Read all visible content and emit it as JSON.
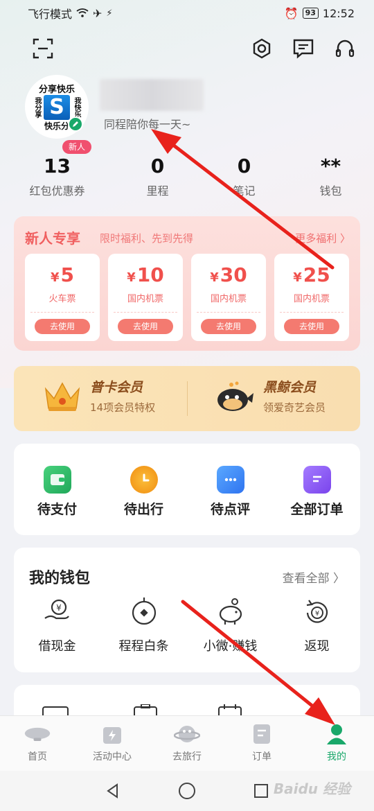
{
  "status_bar": {
    "left_text": "飞行模式",
    "battery": "93",
    "time": "12:52"
  },
  "profile": {
    "avatar": {
      "top": "分享快乐",
      "left": "我分享",
      "right": "我快乐",
      "bottom": "快乐分",
      "logo": "S"
    },
    "new_tag": "新人",
    "slogan": "同程陪你每一天~"
  },
  "stats": [
    {
      "value": "13",
      "label": "红包优惠券"
    },
    {
      "value": "0",
      "label": "里程"
    },
    {
      "value": "0",
      "label": "笔记"
    },
    {
      "value": "**",
      "label": "钱包"
    }
  ],
  "newbie": {
    "title": "新人专享",
    "subtitle": "限时福利、先到先得",
    "more": "更多福利 〉",
    "coupons": [
      {
        "currency": "¥",
        "amount": "5",
        "type": "火车票",
        "action": "去使用"
      },
      {
        "currency": "¥",
        "amount": "10",
        "type": "国内机票",
        "action": "去使用"
      },
      {
        "currency": "¥",
        "amount": "30",
        "type": "国内机票",
        "action": "去使用"
      },
      {
        "currency": "¥",
        "amount": "25",
        "type": "国内机票",
        "action": "去使用"
      }
    ]
  },
  "membership": [
    {
      "title": "普卡会员",
      "subtitle": "14项会员特权"
    },
    {
      "title": "黑鲸会员",
      "subtitle": "领爱奇艺会员"
    }
  ],
  "orders": [
    {
      "label": "待支付",
      "icon": "wallet-icon",
      "color": "#2bbf6a"
    },
    {
      "label": "待出行",
      "icon": "clock-icon",
      "color": "#f7a21b"
    },
    {
      "label": "待点评",
      "icon": "chat-icon",
      "color": "#3f8df5"
    },
    {
      "label": "全部订单",
      "icon": "list-icon",
      "color": "#8a5cf6"
    }
  ],
  "wallet": {
    "title": "我的钱包",
    "more": "查看全部 〉",
    "items": [
      {
        "label": "借现金",
        "icon": "cash-hand-icon"
      },
      {
        "label": "程程白条",
        "icon": "coin-icon"
      },
      {
        "label": "小微·赚钱",
        "icon": "piggy-bank-icon"
      },
      {
        "label": "返现",
        "icon": "cashback-icon"
      }
    ]
  },
  "tabbar": [
    {
      "label": "首页",
      "icon": "airship-icon",
      "active": false
    },
    {
      "label": "活动中心",
      "icon": "lightning-bag-icon",
      "active": false
    },
    {
      "label": "去旅行",
      "icon": "planet-icon",
      "active": false
    },
    {
      "label": "订单",
      "icon": "order-doc-icon",
      "active": false
    },
    {
      "label": "我的",
      "icon": "person-icon",
      "active": true
    }
  ],
  "watermark": "Baidu 经验",
  "colors": {
    "brand_green": "#19a86a",
    "coupon_red": "#f0504c",
    "annotation_red": "#e8221c"
  }
}
